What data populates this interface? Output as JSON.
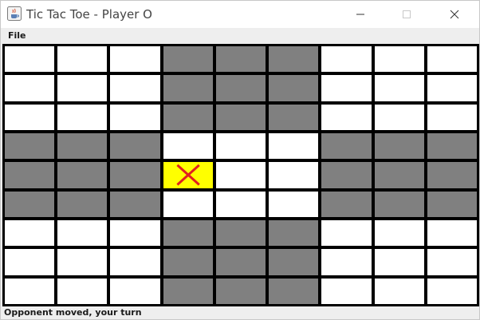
{
  "window": {
    "title": "Tic Tac Toe - Player O",
    "icon": "java-cup-icon",
    "controls": [
      "minimize-icon",
      "maximize-icon",
      "close-icon"
    ]
  },
  "menu": {
    "items": [
      {
        "label": "File"
      }
    ]
  },
  "colors": {
    "cell_active": "#ffffff",
    "cell_inactive": "#808080",
    "cell_last_move": "#ffff00",
    "grid_lines": "#000000",
    "x_mark": "#e02020"
  },
  "board": {
    "rows": [
      [
        "white",
        "white",
        "white",
        "gray",
        "gray",
        "gray",
        "white",
        "white",
        "white"
      ],
      [
        "white",
        "white",
        "white",
        "gray",
        "gray",
        "gray",
        "white",
        "white",
        "white"
      ],
      [
        "white",
        "white",
        "white",
        "gray",
        "gray",
        "gray",
        "white",
        "white",
        "white"
      ],
      [
        "gray",
        "gray",
        "gray",
        "white",
        "white",
        "white",
        "gray",
        "gray",
        "gray"
      ],
      [
        "gray",
        "gray",
        "gray",
        "yellow",
        "white",
        "white",
        "gray",
        "gray",
        "gray"
      ],
      [
        "gray",
        "gray",
        "gray",
        "white",
        "white",
        "white",
        "gray",
        "gray",
        "gray"
      ],
      [
        "white",
        "white",
        "white",
        "gray",
        "gray",
        "gray",
        "white",
        "white",
        "white"
      ],
      [
        "white",
        "white",
        "white",
        "gray",
        "gray",
        "gray",
        "white",
        "white",
        "white"
      ],
      [
        "white",
        "white",
        "white",
        "gray",
        "gray",
        "gray",
        "white",
        "white",
        "white"
      ]
    ],
    "marks": [
      {
        "row": 4,
        "col": 3,
        "symbol": "X"
      }
    ]
  },
  "status": {
    "text": "Opponent moved, your turn"
  }
}
